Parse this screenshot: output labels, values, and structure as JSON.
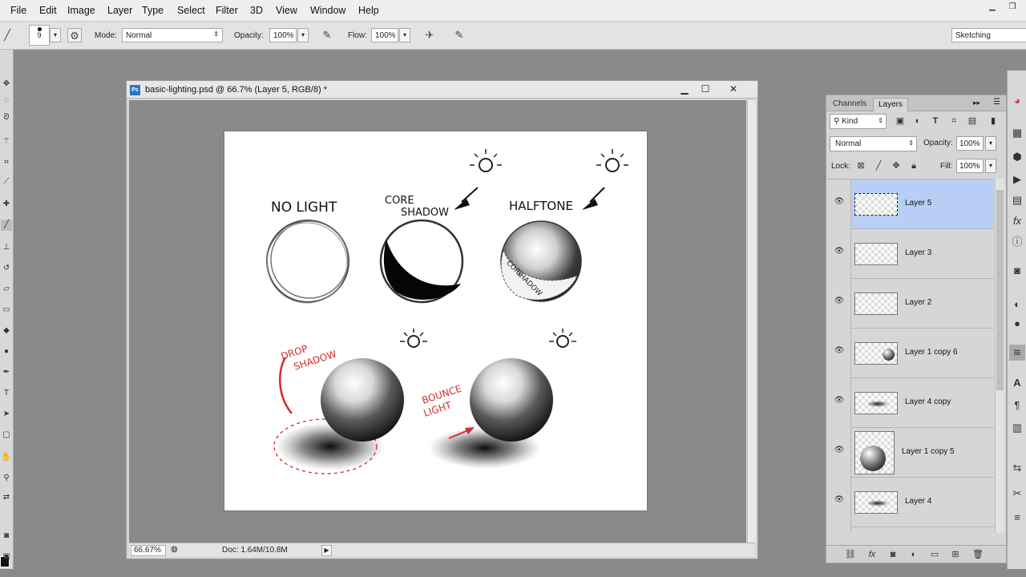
{
  "menubar": {
    "items": [
      "File",
      "Edit",
      "Image",
      "Layer",
      "Type",
      "Select",
      "Filter",
      "3D",
      "View",
      "Window",
      "Help"
    ]
  },
  "options": {
    "brush_size": "9",
    "mode_label": "Mode:",
    "mode_value": "Normal",
    "opacity_label": "Opacity:",
    "opacity_value": "100%",
    "flow_label": "Flow:",
    "flow_value": "100%",
    "workspace": "Sketching"
  },
  "document": {
    "title": "basic-lighting.psd @ 66.7% (Layer 5, RGB/8) *",
    "zoom": "66.67%",
    "doc_info": "Doc: 1.64M/10.8M",
    "canvas_labels": {
      "no_light": "NO LIGHT",
      "core_shadow_1": "CORE",
      "core_shadow_2": "SHADOW",
      "halftone": "HALFTONE",
      "core_in_1": "CORE",
      "core_in_2": "SHADOW",
      "drop_shadow_1": "DROP",
      "drop_shadow_2": "SHADOW",
      "bounce_1": "BOUNCE",
      "bounce_2": "LIGHT"
    }
  },
  "layers_panel": {
    "tabs": [
      "Channels",
      "Layers"
    ],
    "active_tab": "Layers",
    "kind": "Kind",
    "blend_mode": "Normal",
    "opacity_label": "Opacity:",
    "opacity_value": "100%",
    "lock_label": "Lock:",
    "fill_label": "Fill:",
    "fill_value": "100%",
    "layers": [
      {
        "name": "Layer 5",
        "selected": true
      },
      {
        "name": "Layer 3",
        "selected": false
      },
      {
        "name": "Layer 2",
        "selected": false
      },
      {
        "name": "Layer 1 copy 6",
        "selected": false
      },
      {
        "name": "Layer 4 copy",
        "selected": false
      },
      {
        "name": "Layer 1 copy 5",
        "selected": false
      },
      {
        "name": "Layer 4",
        "selected": false
      }
    ]
  },
  "colors": {
    "selection": "#b8cef5",
    "accent_red": "#d62b2b"
  }
}
